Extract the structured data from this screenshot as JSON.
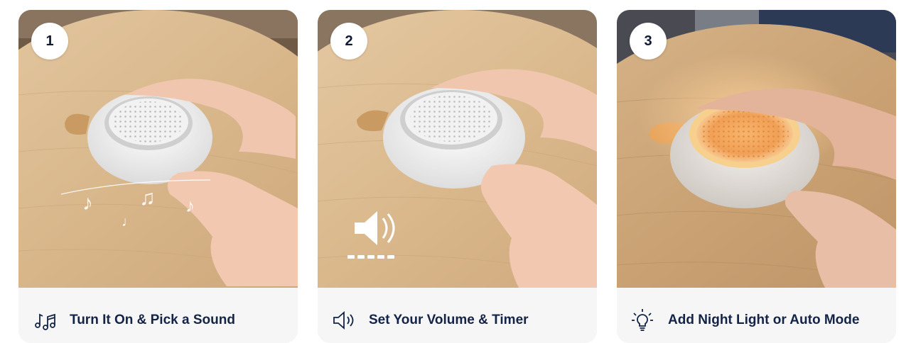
{
  "steps": [
    {
      "number": "1",
      "title": "Turn It On & Pick a Sound",
      "icon": "music-notes-icon",
      "photo": "device-power-on-photo"
    },
    {
      "number": "2",
      "title": "Set Your Volume & Timer",
      "icon": "speaker-volume-icon",
      "photo": "device-volume-photo"
    },
    {
      "number": "3",
      "title": "Add Night Light or Auto Mode",
      "icon": "light-bulb-icon",
      "photo": "device-night-light-photo"
    }
  ],
  "colors": {
    "caption_text": "#142447",
    "badge_text": "#111a33",
    "card_background": "#f6f6f6",
    "wood": "#d9b98f",
    "glow": "#f3a85a"
  }
}
